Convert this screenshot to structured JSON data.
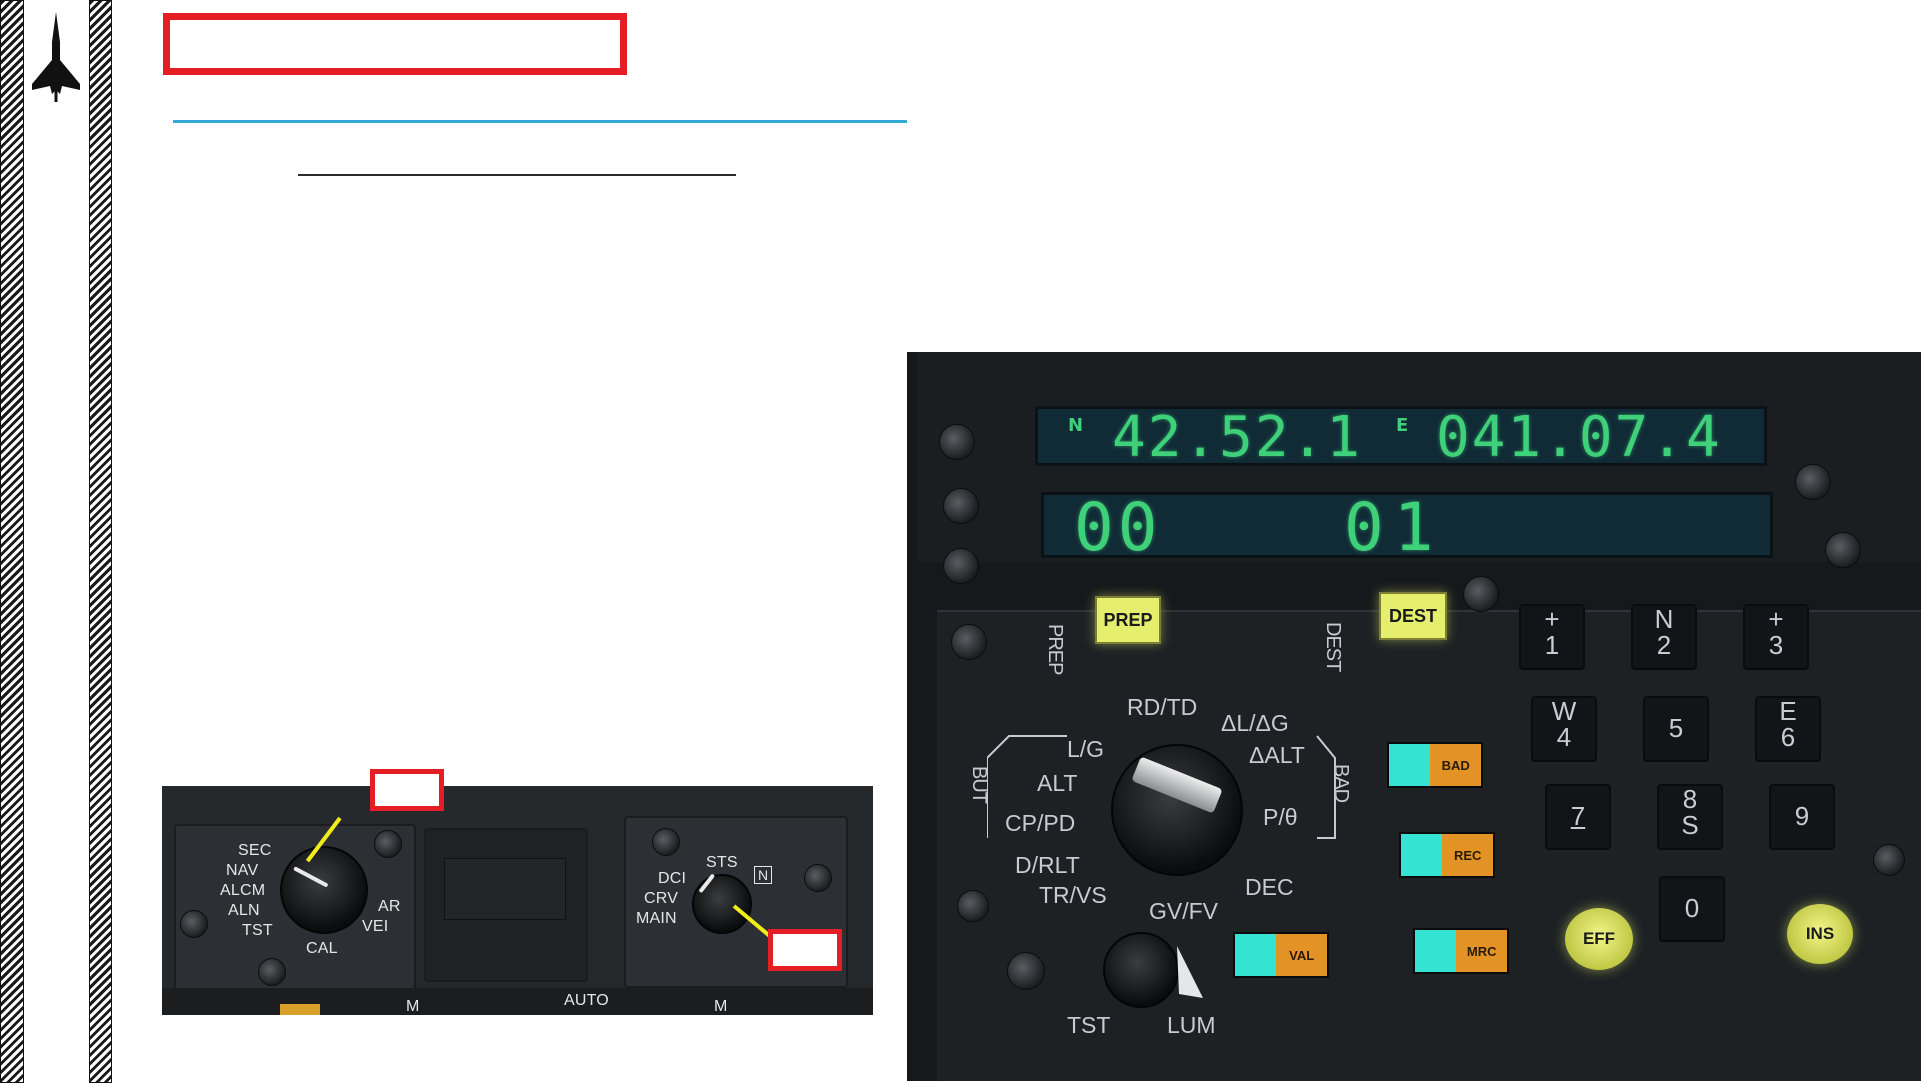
{
  "nav_panel": {
    "mode_selector_labels": [
      "SEC",
      "NAV",
      "ALCM",
      "ALN",
      "TST",
      "CAL",
      "VEI",
      "AR"
    ],
    "submode_labels": [
      "STS",
      "DCI",
      "CRV",
      "MAIN"
    ],
    "indicator_letter": "N",
    "bottom_labels": [
      "AUTO",
      "M",
      "M"
    ]
  },
  "pcn": {
    "display_top": {
      "lat_hemisphere": "N",
      "lat_value": "42.52.1",
      "lon_hemisphere": "E",
      "lon_value": "041.07.4"
    },
    "display_bottom": {
      "left_value": "00",
      "right_value": "01"
    },
    "buttons": {
      "prep": "PREP",
      "dest": "DEST",
      "eff": "EFF",
      "ins": "INS"
    },
    "side_labels": {
      "prep_vertical": "PREP",
      "dest_vertical": "DEST",
      "but_vertical": "BUT",
      "bad_vertical": "BAD"
    },
    "selector_labels": {
      "lg": "L/G",
      "rdtd": "RD/TD",
      "dl_dg": "ΔL/ΔG",
      "alt": "ALT",
      "dalt": "ΔALT",
      "cppd": "CP/PD",
      "ptheta": "P/θ",
      "drlt": "D/RLT",
      "trvs": "TR/VS",
      "dec": "DEC",
      "gvfv": "GV/FV",
      "tst": "TST",
      "lum": "LUM"
    },
    "lamps": {
      "bad": "BAD",
      "rec": "REC",
      "val": "VAL",
      "mrc": "MRC"
    },
    "keypad": [
      {
        "top": "+",
        "bottom": "1"
      },
      {
        "top": "N",
        "bottom": "2"
      },
      {
        "top": "+",
        "bottom": "3"
      },
      {
        "top": "W",
        "bottom": "4"
      },
      {
        "top": "",
        "bottom": "5"
      },
      {
        "top": "E",
        "bottom": "6"
      },
      {
        "top": "",
        "bottom": "7"
      },
      {
        "top": "8",
        "bottom": "S"
      },
      {
        "top": "",
        "bottom": "9"
      },
      {
        "top": "",
        "bottom": "0"
      }
    ]
  },
  "colors": {
    "callout_red": "#e31e24",
    "accent_cyan": "#33a8d6",
    "lcd_green": "#3fd07a",
    "button_yellow": "#e6ef6d",
    "lamp_cyan": "#35e3d2",
    "lamp_orange": "#e39325",
    "arrow_yellow": "#f2ec1a"
  }
}
